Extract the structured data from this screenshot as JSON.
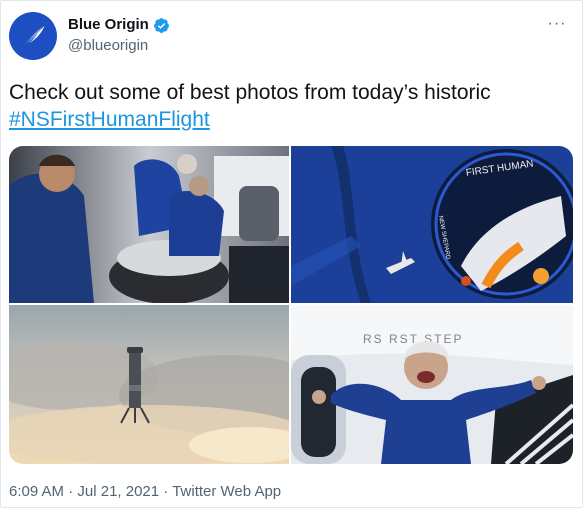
{
  "author": {
    "display_name": "Blue Origin",
    "handle": "@blueorigin",
    "verified": true,
    "avatar_icon": "feather-icon",
    "avatar_color": "#1d4fc2"
  },
  "tweet": {
    "text": "Check out some of best photos from today’s historic",
    "hashtag": "#NSFirstHumanFlight"
  },
  "media": [
    {
      "description_icon": "astronauts-cabin-photo"
    },
    {
      "description_icon": "mission-patch-photo",
      "patch_text": "FIRST HUMAN",
      "patch_side_text": "NEW SHEPARD"
    },
    {
      "description_icon": "rocket-launch-photo"
    },
    {
      "description_icon": "astronaut-celebrating-photo",
      "hatch_text": "RS    RST STEP"
    }
  ],
  "meta": {
    "time": "6:09 AM",
    "separator": " · ",
    "date": "Jul 21, 2021",
    "source": "Twitter Web App"
  },
  "colors": {
    "link": "#1b95e0",
    "verified": "#1d9bf0",
    "muted": "#536471"
  }
}
